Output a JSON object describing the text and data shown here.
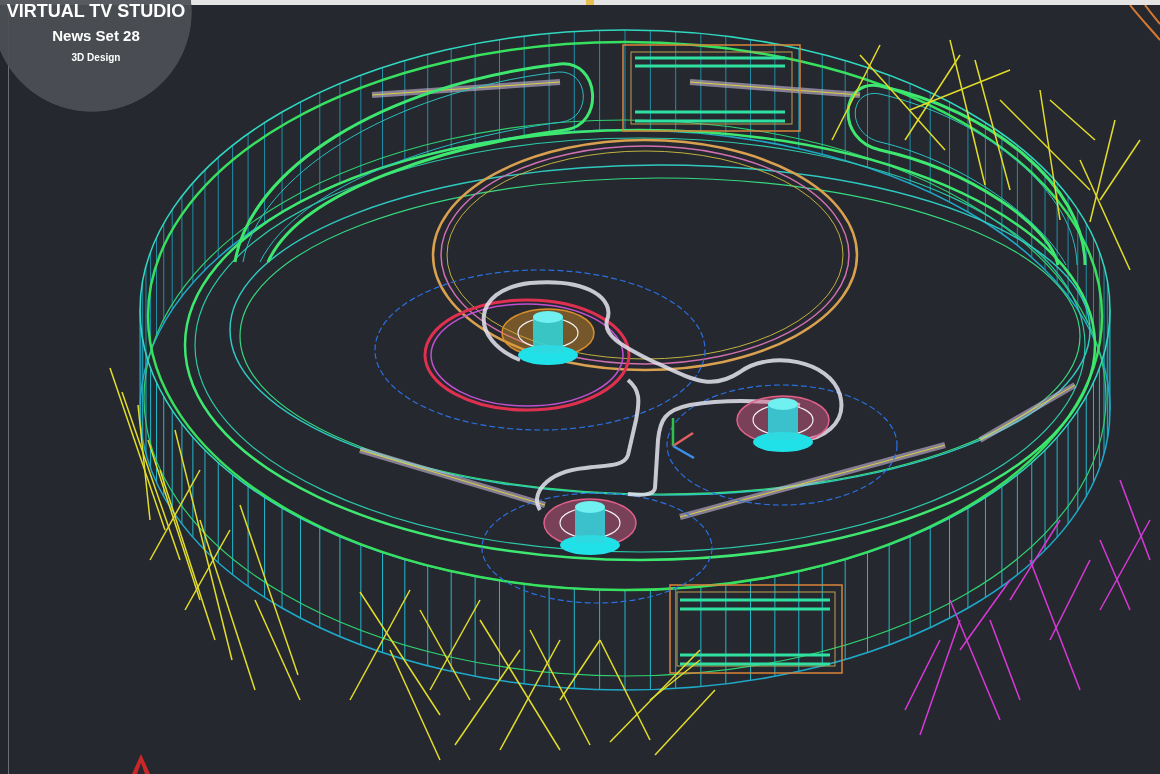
{
  "logo_badge": {
    "title": "VIRTUAL TV STUDIO",
    "subtitle": "News Set 28",
    "caption": "3D Design"
  }
}
